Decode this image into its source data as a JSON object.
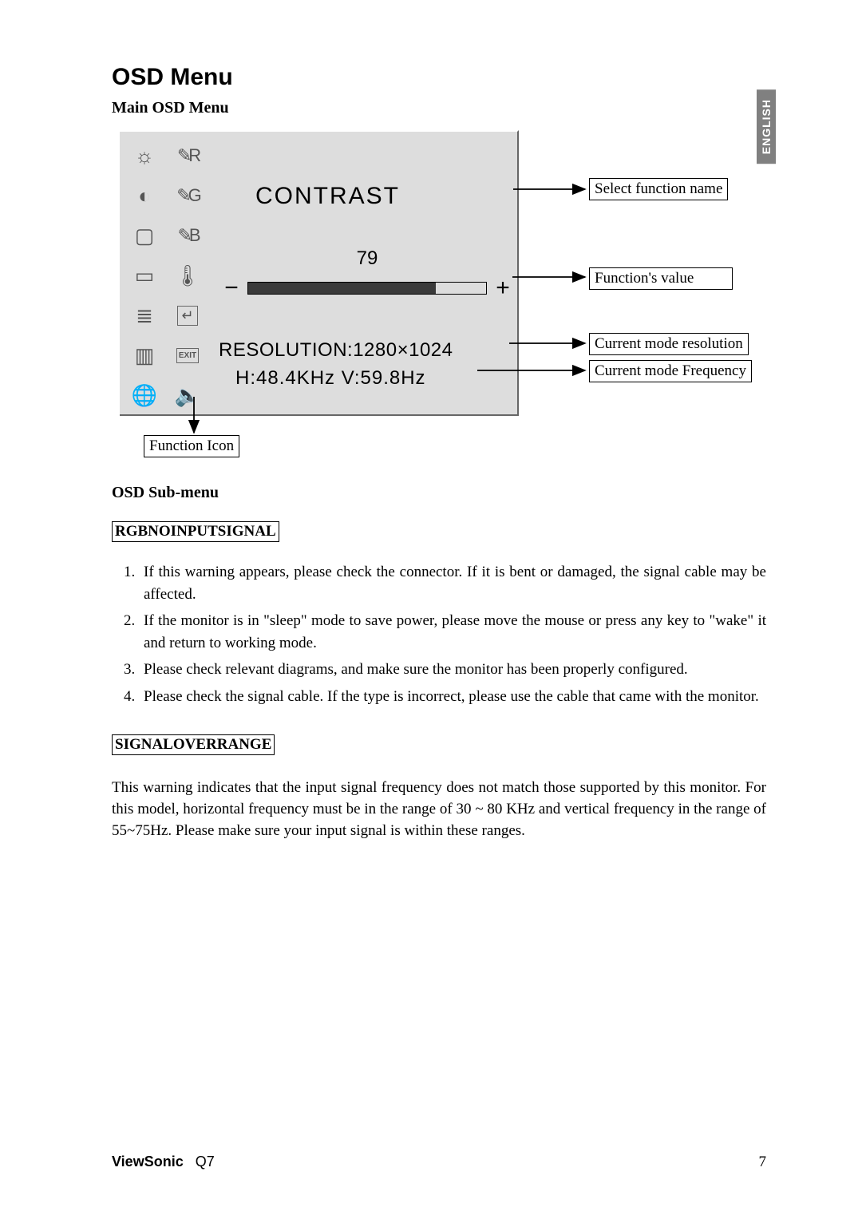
{
  "side_tab": "ENGLISH",
  "title": "OSD Menu",
  "main_label": "Main OSD Menu",
  "osd": {
    "title": "CONTRAST",
    "value": "79",
    "minus": "−",
    "plus": "+",
    "resolution": "RESOLUTION:1280×1024",
    "frequency": "H:48.4KHz   V:59.8Hz"
  },
  "annotations": {
    "function_name": "Select function name",
    "function_value": "Function's value",
    "mode_resolution": "Current mode resolution",
    "mode_frequency": "Current mode Frequency",
    "function_icon": "Function Icon"
  },
  "sub_heading": "OSD Sub-menu",
  "boxed_rgb": "RGBNOINPUTSIGNAL",
  "steps": {
    "s1": "If this warning appears, please check the connector. If it is bent or damaged, the signal cable may be affected.",
    "s2": "If the monitor is in \"sleep\" mode to save power, please move the mouse or press any key to \"wake\" it and return to working mode.",
    "s3": "Please check relevant diagrams, and make sure the monitor has been properly configured.",
    "s4": "Please check the signal cable. If the type is incorrect, please use the cable that came with the monitor."
  },
  "boxed_signal": "SIGNALOVERRANGE",
  "over_range_para": "This warning indicates that the input signal frequency does not match those supported by this monitor. For this model, horizontal frequency must be in the range of 30 ~ 80 KHz and vertical frequency in the range of 55~75Hz. Please make sure your input signal is within these ranges.",
  "footer": {
    "brand": "ViewSonic",
    "model": "Q7",
    "page": "7"
  },
  "icons": {
    "bright": "☼",
    "brushR": "✎R",
    "contrast": "◐",
    "brushG": "✎G",
    "square": "▢",
    "brushB": "✎B",
    "window": "▭",
    "thermo": "🌡",
    "list": "≣",
    "enter": "↵",
    "stripes": "▥",
    "exit": "EXIT",
    "globe": "🌐",
    "sound": "🔈"
  }
}
